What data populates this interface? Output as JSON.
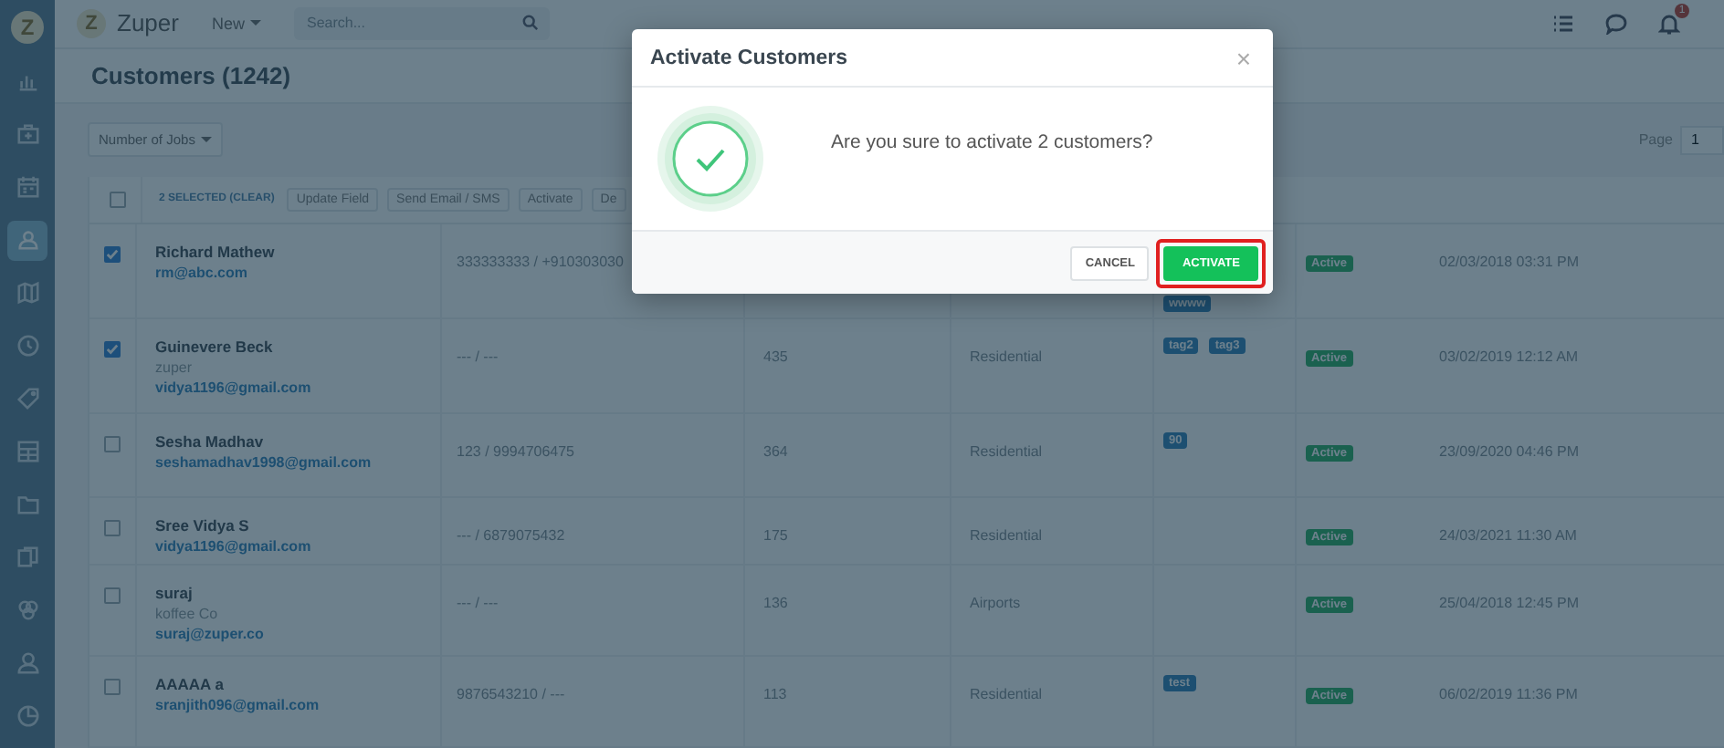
{
  "sidebar": {
    "logo": "Z",
    "items": [
      {
        "selected": false
      },
      {
        "selected": false
      },
      {
        "selected": false
      },
      {
        "selected": true
      },
      {
        "selected": false
      },
      {
        "selected": false
      },
      {
        "selected": false
      },
      {
        "selected": false
      },
      {
        "selected": false
      },
      {
        "selected": false
      },
      {
        "selected": false
      },
      {
        "selected": false
      },
      {
        "selected": false
      }
    ]
  },
  "topbar": {
    "logo": "Z",
    "brand": "Zuper",
    "new_menu": "New",
    "search": {
      "placeholder": "Search..."
    },
    "notification_count": "1"
  },
  "page": {
    "title": "Customers (1242)",
    "filter": "Number of Jobs",
    "pagination": {
      "label": "Page",
      "value": "1"
    }
  },
  "bulk_bar": {
    "checked": false,
    "selection": "2 SELECTED (CLEAR)",
    "actions": [
      "Update Field",
      "Send Email / SMS",
      "Activate",
      "De"
    ]
  },
  "table": {
    "rows": [
      {
        "checked": true,
        "name": "Richard Mathew",
        "email": "rm@abc.com",
        "phone": "333333333 / +910303030",
        "tags": [
          "wwww"
        ],
        "status": "Active",
        "date": "02/03/2018 03:31 PM"
      },
      {
        "checked": true,
        "name": "Guinevere Beck",
        "company": "zuper",
        "email": "vidya1196@gmail.com",
        "phone": "--- / ---",
        "jobs": "435",
        "category": "Residential",
        "tags": [
          "tag2",
          "tag3"
        ],
        "status": "Active",
        "date": "03/02/2019 12:12 AM"
      },
      {
        "checked": false,
        "name": "Sesha Madhav",
        "email": "seshamadhav1998@gmail.com",
        "phone": "123 / 9994706475",
        "jobs": "364",
        "category": "Residential",
        "tags": [
          "90"
        ],
        "status": "Active",
        "date": "23/09/2020 04:46 PM"
      },
      {
        "checked": false,
        "name": "Sree Vidya S",
        "email": "vidya1196@gmail.com",
        "phone": "--- / 6879075432",
        "jobs": "175",
        "category": "Residential",
        "tags": [],
        "status": "Active",
        "date": "24/03/2021 11:30 AM"
      },
      {
        "checked": false,
        "name": "suraj",
        "company": "koffee Co",
        "email": "suraj@zuper.co",
        "phone": "--- / ---",
        "jobs": "136",
        "category": "Airports",
        "tags": [],
        "status": "Active",
        "date": "25/04/2018 12:45 PM"
      },
      {
        "checked": false,
        "name": "AAAAA a",
        "email": "sranjith096@gmail.com",
        "phone": "9876543210 / ---",
        "jobs": "113",
        "category": "Residential",
        "tags": [
          "test"
        ],
        "status": "Active",
        "date": "06/02/2019 11:36 PM"
      }
    ]
  },
  "modal": {
    "title": "Activate Customers",
    "close": "×",
    "message": "Are you sure to activate 2 customers?",
    "buttons": [
      {
        "label": "CANCEL",
        "kind": "secondary",
        "highlighted": false
      },
      {
        "label": "ACTIVATE",
        "kind": "primary",
        "highlighted": true
      }
    ]
  }
}
